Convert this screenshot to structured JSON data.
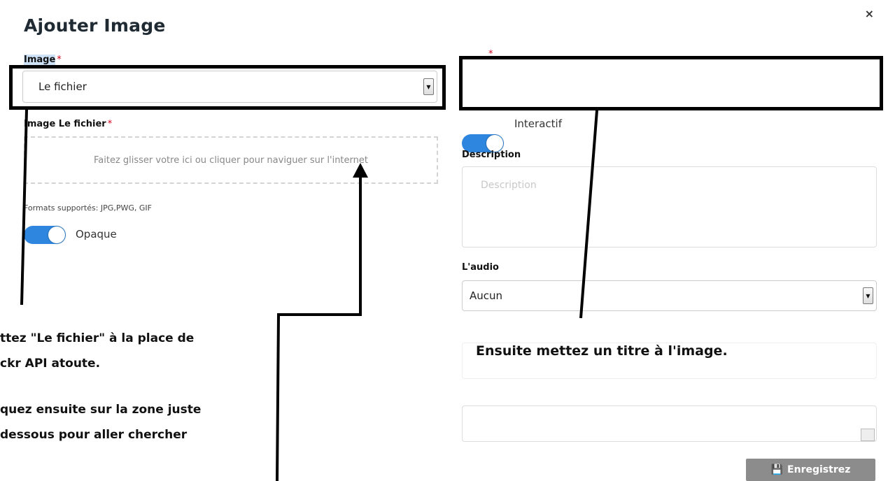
{
  "dialog": {
    "title": "Ajouter  Image",
    "close_glyph": "×"
  },
  "left": {
    "image_label": "Image",
    "required_mark": "*",
    "image_select_value": "Le fichier",
    "file_label": "Image Le fichier",
    "dropzone_text": "Faitez glisser votre ici ou cliquer pour naviguer sur l'internet",
    "formats_hint": "Formats supportés: JPG,PWG, GIF",
    "opaque_label": "Opaque"
  },
  "right": {
    "required_mark": "*",
    "interactif_label": "Interactif",
    "description_label": "Description",
    "description_placeholder": "Description",
    "audio_label": "L'audio",
    "audio_select_value": "Aucun",
    "save_label": "Enregistrez"
  },
  "annotations": {
    "left_line1": "ttez \"Le fichier\" à la place de",
    "left_line2": "ckr API atoute.",
    "left_line3": "quez ensuite sur la zone juste",
    "left_line4": "dessous pour aller chercher",
    "right_note": "Ensuite mettez un titre à l'image."
  },
  "colors": {
    "toggle_on": "#2e86de",
    "required": "#d0021b",
    "save_button": "#8c8c8c",
    "annotation": "#000000"
  }
}
